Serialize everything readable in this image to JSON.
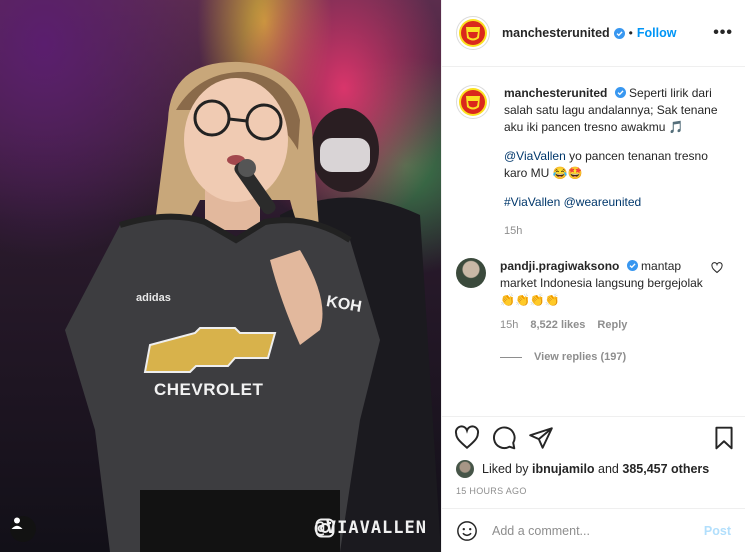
{
  "header": {
    "username": "manchesterunited",
    "follow_label": "Follow",
    "dot": "•",
    "more_label": "•••"
  },
  "caption": {
    "username": "manchesterunited",
    "text": "Seperti lirik dari salah satu lagu andalannya; Sak tenane aku iki pancen tresno awakmu 🎵",
    "mention_user": "@ViaVallen",
    "line2_text": " yo pancen tenanan tresno karo MU 😂🤩",
    "hashtag": "#ViaVallen",
    "mention2": "@weareunited",
    "time": "15h"
  },
  "reply": {
    "username": "pandji.pragiwaksono",
    "text": " mantap market Indonesia langsung bergejolak 👏👏👏👏",
    "time": "15h",
    "likes": "8,522 likes",
    "reply_label": "Reply",
    "view_replies": "View replies (197)"
  },
  "likes": {
    "prefix": "Liked by ",
    "user": "ibnujamilo",
    "middle": " and ",
    "count": "385,457 others"
  },
  "posted": "15 HOURS AGO",
  "comment_box": {
    "placeholder": "Add a comment...",
    "post_label": "Post"
  },
  "photo": {
    "watermark": "@VIAVALLEN",
    "jersey_sponsor": "CHEVROLET",
    "jersey_brand": "adidas",
    "sleeve_text": "KOH"
  },
  "colors": {
    "accent": "#0095f6",
    "mention": "#00376b",
    "muted": "#8e8e8e",
    "post_disabled": "#b2dffc",
    "mu_red": "#da291c",
    "mu_yellow": "#fbe122"
  }
}
